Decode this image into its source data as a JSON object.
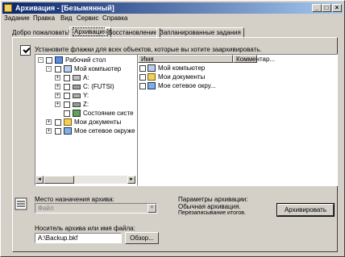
{
  "window": {
    "title": "Архивация - [Безымянный]",
    "controls": [
      "_",
      "□",
      "×"
    ]
  },
  "menu": [
    "Задание",
    "Правка",
    "Вид",
    "Сервис",
    "Справка"
  ],
  "tabs": [
    {
      "label": "Добро пожаловать!",
      "active": false
    },
    {
      "label": "Архивация",
      "active": true
    },
    {
      "label": "Восстановление",
      "active": false
    },
    {
      "label": "Запланированные задания",
      "active": false
    }
  ],
  "instruction": "Установите флажки для всех объектов, которые вы хотите заархивировать.",
  "tree": {
    "items": [
      {
        "label": "Рабочий стол",
        "expander": "-",
        "icon": "desktop-icon"
      },
      {
        "label": "Мой компьютер",
        "expander": "-",
        "icon": "computer-icon"
      },
      {
        "label": "A:",
        "expander": "+",
        "icon": "floppy-drive-icon"
      },
      {
        "label": "C: (FUTSI)",
        "expander": "+",
        "icon": "hard-drive-icon"
      },
      {
        "label": "Y:",
        "expander": "+",
        "icon": "cd-drive-icon"
      },
      {
        "label": "Z:",
        "expander": "+",
        "icon": "network-drive-icon"
      },
      {
        "label": "Состояние систе",
        "expander": "",
        "icon": "system-state-icon"
      },
      {
        "label": "Мои документы",
        "expander": "+",
        "icon": "my-documents-icon"
      },
      {
        "label": "Мое сетевое окруже",
        "expander": "+",
        "icon": "network-places-icon"
      }
    ]
  },
  "list": {
    "columns": [
      "Имя",
      "Комментар..."
    ],
    "rows": [
      {
        "label": "Мой компьютер",
        "icon": "computer-icon"
      },
      {
        "label": "Мои документы",
        "icon": "my-documents-icon"
      },
      {
        "label": "Мое сетевое окру...",
        "icon": "network-places-icon"
      }
    ]
  },
  "destination": {
    "label": "Место назначения архива:",
    "value": "Файл"
  },
  "media": {
    "label": "Носитель архива или имя файла:",
    "value": "A:\\Backup.bkf",
    "browse_button": "Обзор..."
  },
  "params": {
    "title": "Параметры архивации:",
    "line1": "Обычная архивация.",
    "line2": "Перезаписывание итогов."
  },
  "start_button": "Архивировать",
  "colors": {
    "titlebar_start": "#0a246a",
    "titlebar_end": "#a6caf0",
    "face": "#d4d0c8"
  }
}
